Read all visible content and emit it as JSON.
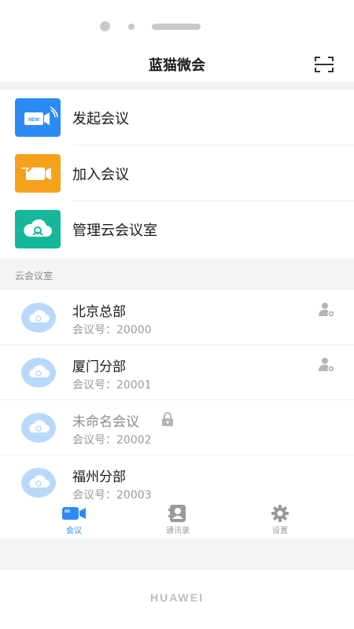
{
  "header": {
    "title": "蓝猫微会",
    "scan_icon": "scan-icon"
  },
  "actions": [
    {
      "label": "发起会议",
      "icon": "new-meeting-icon",
      "color": "#2c8bf3"
    },
    {
      "label": "加入会议",
      "icon": "join-meeting-icon",
      "color": "#f6a11c"
    },
    {
      "label": "管理云会议室",
      "icon": "manage-cloud-room-icon",
      "color": "#14b79a"
    }
  ],
  "section": {
    "title": "云会议室"
  },
  "rooms": [
    {
      "name": "北京总部",
      "id_text": "会议号：20000",
      "icon": "user-settings-icon"
    },
    {
      "name": "厦门分部",
      "id_text": "会议号：20001",
      "icon": "user-settings-icon"
    },
    {
      "name": "未命名会议",
      "id_text": "会议号：20002",
      "icon": "lock-icon"
    },
    {
      "name": "福州分部",
      "id_text": "会议号：20003"
    }
  ],
  "tabs": [
    {
      "label": "会议",
      "icon": "meeting-camera-icon",
      "active": true
    },
    {
      "label": "通讯录",
      "icon": "contacts-icon",
      "active": false
    },
    {
      "label": "设置",
      "icon": "gear-icon",
      "active": false
    }
  ],
  "device": {
    "brand": "HUAWEI"
  },
  "colors": {
    "accent": "#2c8bf3",
    "cloud": "#b9d9fa"
  }
}
